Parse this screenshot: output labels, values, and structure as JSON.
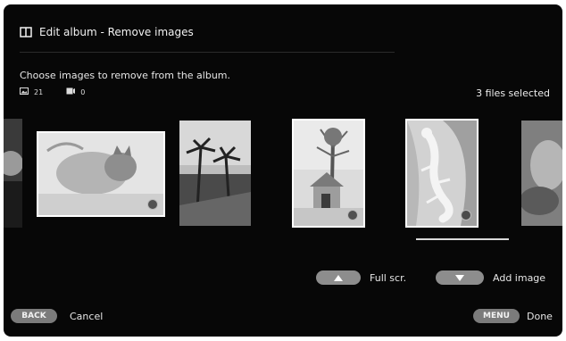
{
  "header": {
    "title": "Edit album - Remove images",
    "icon": "album-icon"
  },
  "instruction": "Choose images to remove from the album.",
  "counts": {
    "photos": "21",
    "videos": "0",
    "photo_icon": "photo-icon",
    "video_icon": "video-icon"
  },
  "selection_status": "3 files selected",
  "thumbnails": [
    {
      "name": "partial-left",
      "selected": false
    },
    {
      "name": "cat-photo",
      "selected": true
    },
    {
      "name": "palm-trees",
      "selected": false
    },
    {
      "name": "doghouse-tree",
      "selected": true
    },
    {
      "name": "lizard",
      "selected": true
    },
    {
      "name": "partial-right",
      "selected": false
    }
  ],
  "actions": {
    "up_label": "Full scr.",
    "down_label": "Add image",
    "back_key": "BACK",
    "back_label": "Cancel",
    "menu_key": "MENU",
    "menu_label": "Done"
  },
  "colors": {
    "background": "#070707",
    "text": "#f2f2f2",
    "pill": "#8d8d8d"
  }
}
